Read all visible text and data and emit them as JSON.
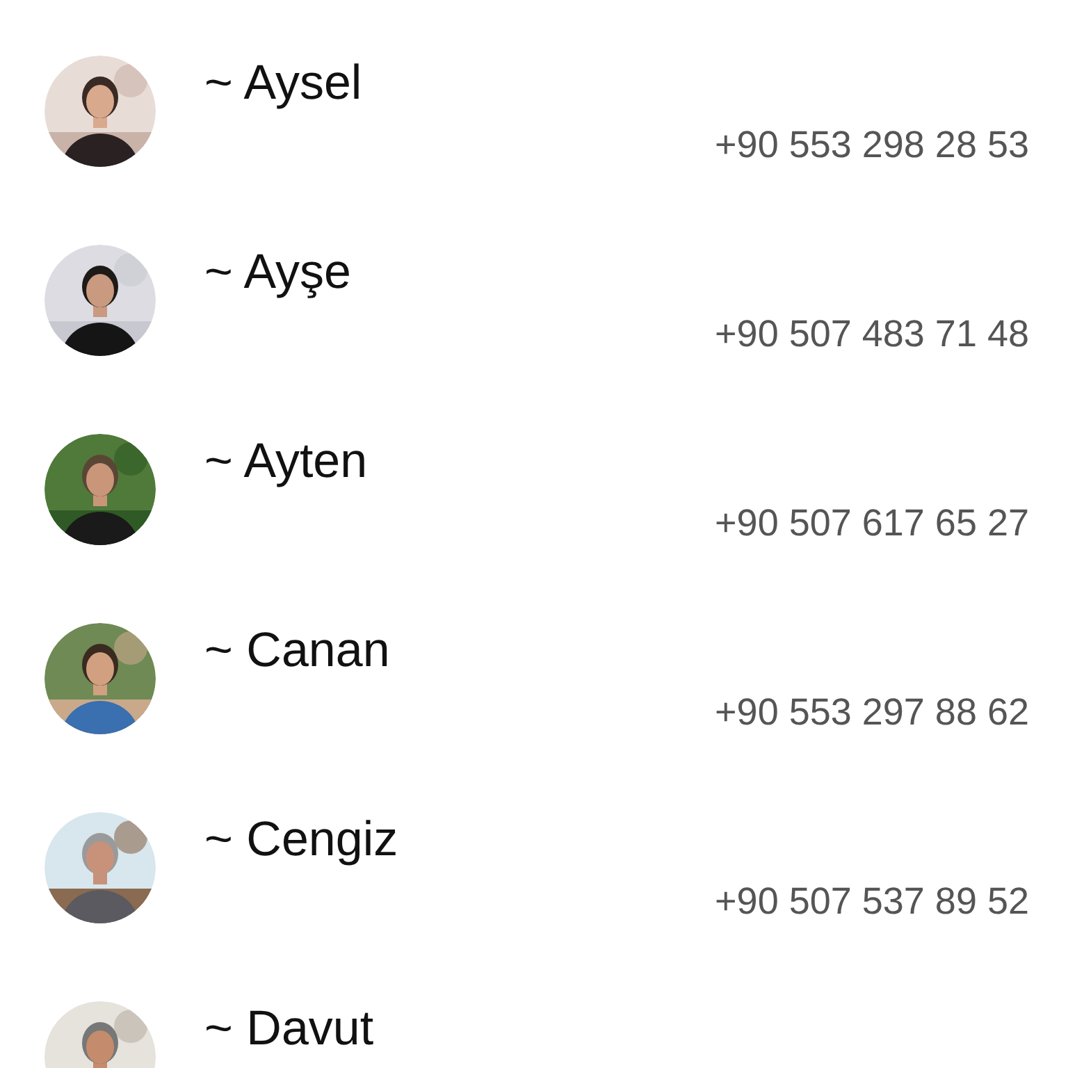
{
  "contacts": [
    {
      "name": "~ Aysel",
      "phone": "+90 553 298 28 53"
    },
    {
      "name": "~ Ayşe",
      "phone": "+90 507 483 71 48"
    },
    {
      "name": "~ Ayten",
      "phone": "+90 507 617 65 27"
    },
    {
      "name": "~ Canan",
      "phone": "+90 553 297 88 62"
    },
    {
      "name": "~ Cengiz",
      "phone": "+90 507 537 89 52"
    },
    {
      "name": "~ Davut"
    }
  ]
}
